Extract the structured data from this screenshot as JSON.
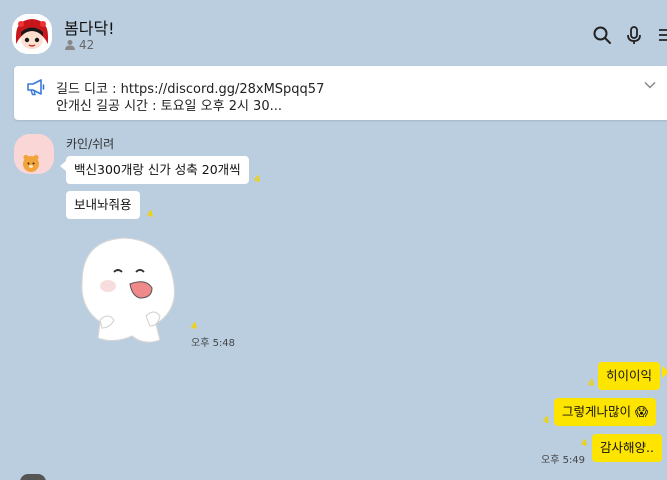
{
  "room": {
    "title": "봄다닥!",
    "member_count": "42"
  },
  "notice": {
    "line1": "길드 디코 : https://discord.gg/28xMSpqq57",
    "line2": "안개신 길공 시간 : 토요일 오후 2시 30..."
  },
  "header_icons": [
    "search-icon",
    "mic-icon",
    "menu-icon"
  ],
  "messages_in": {
    "sender": "카인/쉬려",
    "bubbles": [
      {
        "text": "백신300개랑 신가 성축 20개씩",
        "unread": "4"
      },
      {
        "text": "보내놔줘용",
        "unread": "4"
      }
    ],
    "sticker": {
      "name": "white-blob-character",
      "unread": "4",
      "time": "오후 5:48"
    }
  },
  "messages_out": [
    {
      "text": "히이이익",
      "unread": "4"
    },
    {
      "text": "그렇게나많이 😱",
      "unread": "4"
    },
    {
      "text": "감사해양..",
      "unread": "4",
      "time": "오후 5:49"
    }
  ],
  "colors": {
    "background": "#bacee0",
    "my_bubble": "#fee500",
    "their_bubble": "#ffffff",
    "unread": "#f2d200"
  }
}
